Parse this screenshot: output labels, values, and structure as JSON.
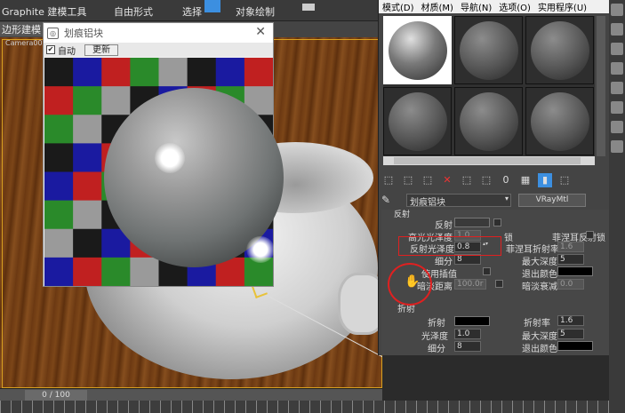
{
  "topbar": {
    "menu1": "Graphite 建模工具",
    "menu2": "自由形式",
    "menu3": "选择",
    "menu4": "对象绘制"
  },
  "subbar": {
    "tab": "边形建模"
  },
  "viewport": {
    "camera_label": "Camera001"
  },
  "timeline": {
    "frame": "0 / 100"
  },
  "preview": {
    "title": "划痕铝块",
    "auto_label": "自动",
    "update_label": "更新"
  },
  "medit": {
    "menu": [
      "模式(D)",
      "材质(M)",
      "导航(N)",
      "选项(O)",
      "实用程序(U)"
    ],
    "material_name": "划痕铝块",
    "material_type": "VRayMtl",
    "section_reflection": "反射",
    "reflect": {
      "reflect_label": "反射",
      "hilight_label": "高光光泽度",
      "hilight_value": "1.0",
      "lock_label": "锁",
      "fresnel_label": "菲涅耳反射",
      "gloss_label": "反射光泽度",
      "gloss_value": "0.8",
      "fresnel_ior_label": "菲涅耳折射率",
      "fresnel_ior_value": "1.6",
      "fresnel_lock_label": "锁",
      "subdivs_label": "细分",
      "subdivs_value": "8",
      "maxdepth_label": "最大深度",
      "maxdepth_value": "5",
      "interp_label": "使用插值",
      "exitcolor_label": "退出颜色",
      "dimdist_label": "暗淡距离",
      "dimdist_value": "100.0r",
      "dimfalloff_label": "暗淡衰减",
      "dimfalloff_value": "0.0"
    },
    "section_refraction": "折射",
    "refract": {
      "refract_label": "折射",
      "ior_label": "折射率",
      "ior_value": "1.6",
      "gloss_label": "光泽度",
      "gloss_value": "1.0",
      "maxdepth_label": "最大深度",
      "maxdepth_value": "5",
      "subdivs_label": "细分",
      "subdivs_value": "8",
      "exitcolor_label": "退出颜色"
    }
  },
  "colors": {
    "highlight_red": "#e02020",
    "accent_blue": "#3c8fe0"
  },
  "checker_colors": [
    "#1a1a1a",
    "#2a8a2a",
    "#1a1aa0",
    "#9a9a9a",
    "#c02020"
  ]
}
